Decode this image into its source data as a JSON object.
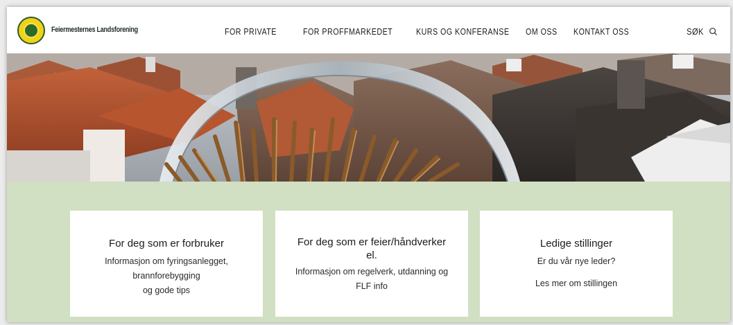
{
  "brand": {
    "name": "Feiermesternes Landsforening"
  },
  "nav": {
    "items": [
      {
        "label": "FOR PRIVATE"
      },
      {
        "label": "FOR PROFFMARKEDET"
      },
      {
        "label": "KURS OG KONFERANSE"
      },
      {
        "label": "OM OSS"
      },
      {
        "label": "KONTAKT OSS"
      }
    ],
    "search_label": "SØK"
  },
  "cards": [
    {
      "title": "For deg som er forbruker",
      "lines": [
        "Informasjon om fyringsanlegget,",
        "brannforebygging",
        "og gode tips"
      ]
    },
    {
      "title_line1": "For deg som er feier/håndverker",
      "title_line2": "el.",
      "lines": [
        "Informasjon om regelverk, utdanning og",
        "FLF info"
      ]
    },
    {
      "title": "Ledige stillinger",
      "text": "Er du vår nye leder?",
      "link": "Les mer om stillingen"
    }
  ],
  "colors": {
    "panel_bg": "#d1dfc2",
    "logo_yellow": "#f0d21a",
    "logo_green": "#2c6a2a"
  },
  "icons": {
    "search": "search-icon"
  }
}
